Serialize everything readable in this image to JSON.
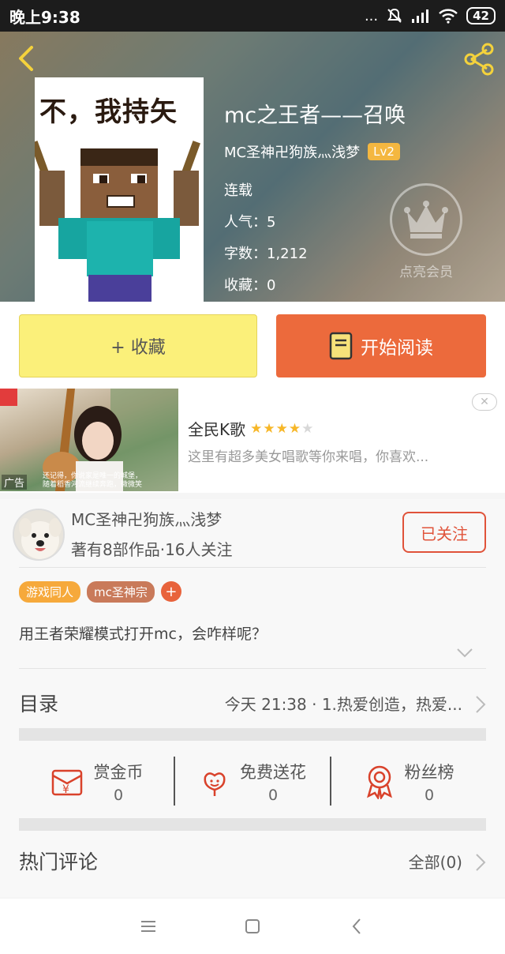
{
  "status_bar": {
    "time": "晚上9:38",
    "signal_text": "...",
    "battery": "42"
  },
  "header": {
    "book_title": "mc之王者——召唤",
    "author": "MC圣神卍狗族灬浅梦",
    "author_level": "Lv2",
    "status": "连载",
    "popularity": "人气：5",
    "word_count": "字数：1,212",
    "favorites": "收藏：0",
    "cover_caption": "不，我持矢",
    "vip_label": "点亮会员"
  },
  "actions": {
    "collect_label": "+ 收藏",
    "read_label": "开始阅读"
  },
  "ad": {
    "app_name": "全民K歌",
    "rating": 4,
    "description": "这里有超多美女唱歌等你来唱，你喜欢...",
    "ad_tag": "广告",
    "subtitle_1": "还记得，你说家是唯一的城堡，",
    "subtitle_2": "随着稻香河流继续奔跑，微微笑"
  },
  "author_section": {
    "name": "MC圣神卍狗族灬浅梦",
    "stats": "著有8部作品·16人关注",
    "follow_label": "已关注",
    "tags": [
      "游戏同人",
      "mc圣神宗"
    ],
    "add_tag": "+",
    "description": "用王者荣耀模式打开mc，会咋样呢？"
  },
  "toc": {
    "label": "目录",
    "latest": "今天 21:38 · 1.热爱创造，热爱..."
  },
  "gifts": [
    {
      "label": "赏金币",
      "count": "0",
      "icon": "coin-envelope-icon"
    },
    {
      "label": "免费送花",
      "count": "0",
      "icon": "flower-icon"
    },
    {
      "label": "粉丝榜",
      "count": "0",
      "icon": "ribbon-award-icon"
    }
  ],
  "comments": {
    "label": "热门评论",
    "all_label": "全部(0)"
  },
  "colors": {
    "accent_orange": "#ec6a3c",
    "collect_yellow": "#fbf07a",
    "level_badge": "#f4b740",
    "follow_red": "#e0533a",
    "gift_red": "#d9422b"
  }
}
